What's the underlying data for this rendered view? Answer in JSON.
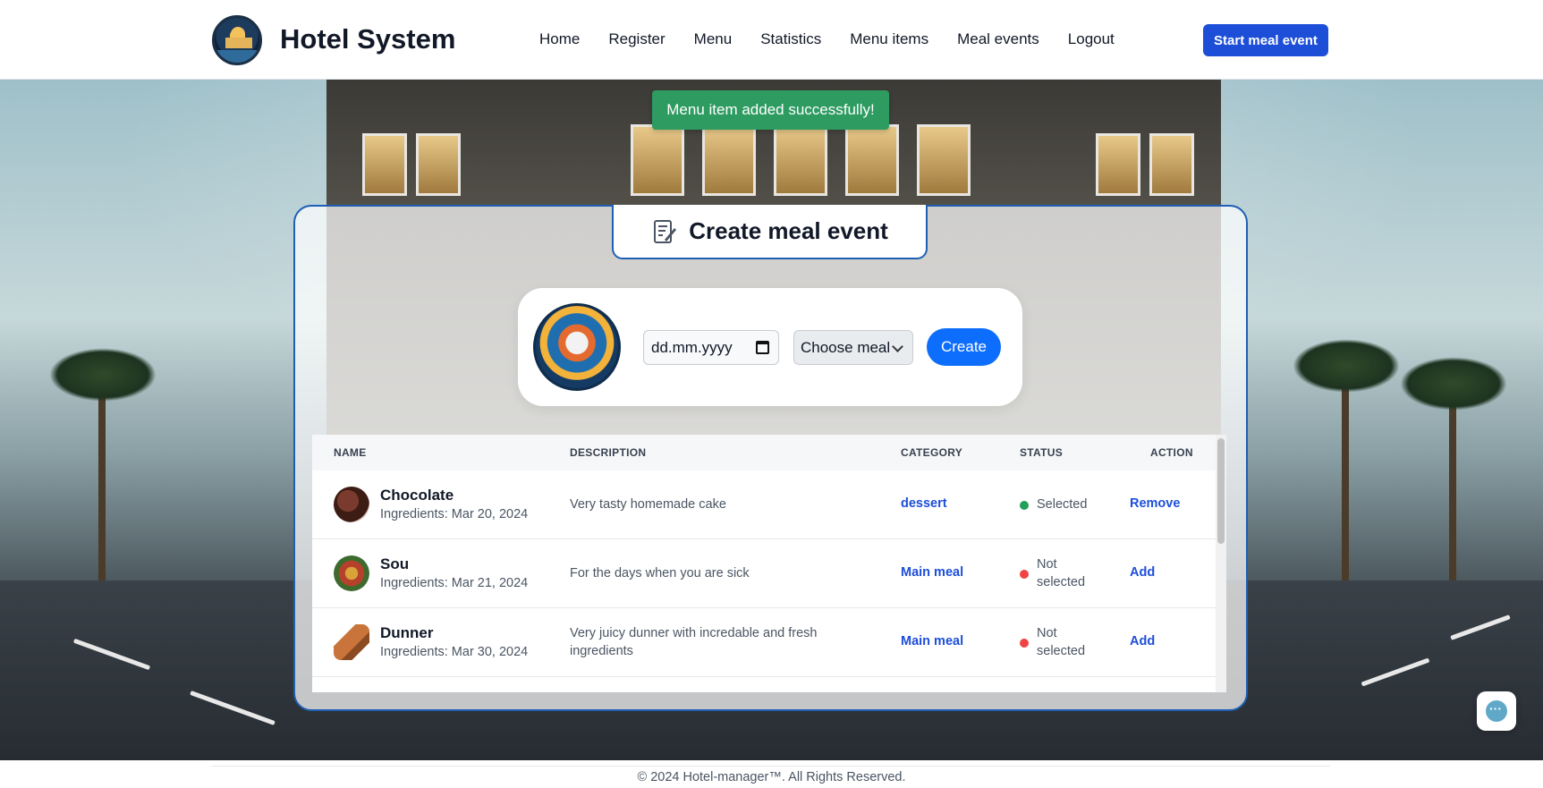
{
  "header": {
    "brand": "Hotel System",
    "nav": [
      "Home",
      "Register",
      "Menu",
      "Statistics",
      "Menu items",
      "Meal events",
      "Logout"
    ],
    "cta": "Start meal event"
  },
  "toast": {
    "message": "Menu item added successfully!"
  },
  "panel": {
    "title": "Create meal event",
    "title_icon": "notepad-edit-icon"
  },
  "form": {
    "date_placeholder": "dd.mm.yyyy",
    "meal_select": "Choose meal",
    "create_label": "Create"
  },
  "table": {
    "columns": [
      "NAME",
      "DESCRIPTION",
      "CATEGORY",
      "STATUS",
      "ACTION"
    ],
    "rows": [
      {
        "name": "Chocolate",
        "ingredients": "Ingredients: Mar 20, 2024",
        "description": "Very tasty homemade cake",
        "category": "dessert",
        "status": "Selected",
        "status_color": "#22a05a",
        "action": "Remove"
      },
      {
        "name": "Sou",
        "ingredients": "Ingredients: Mar 21, 2024",
        "description": "For the days when you are sick",
        "category": "Main meal",
        "status": "Not selected",
        "status_color": "#ef4444",
        "action": "Add"
      },
      {
        "name": "Dunner",
        "ingredients": "Ingredients: Mar 30, 2024",
        "description": "Very juicy dunner with incredable and fresh ingredients",
        "category": "Main meal",
        "status": "Not selected",
        "status_color": "#ef4444",
        "action": "Add"
      }
    ]
  },
  "footer": {
    "text": "© 2024 Hotel-manager™. All Rights Reserved."
  },
  "colors": {
    "primary": "#1d4ed8",
    "toast": "#2e9b61",
    "panel_border": "#1e5fb4"
  }
}
